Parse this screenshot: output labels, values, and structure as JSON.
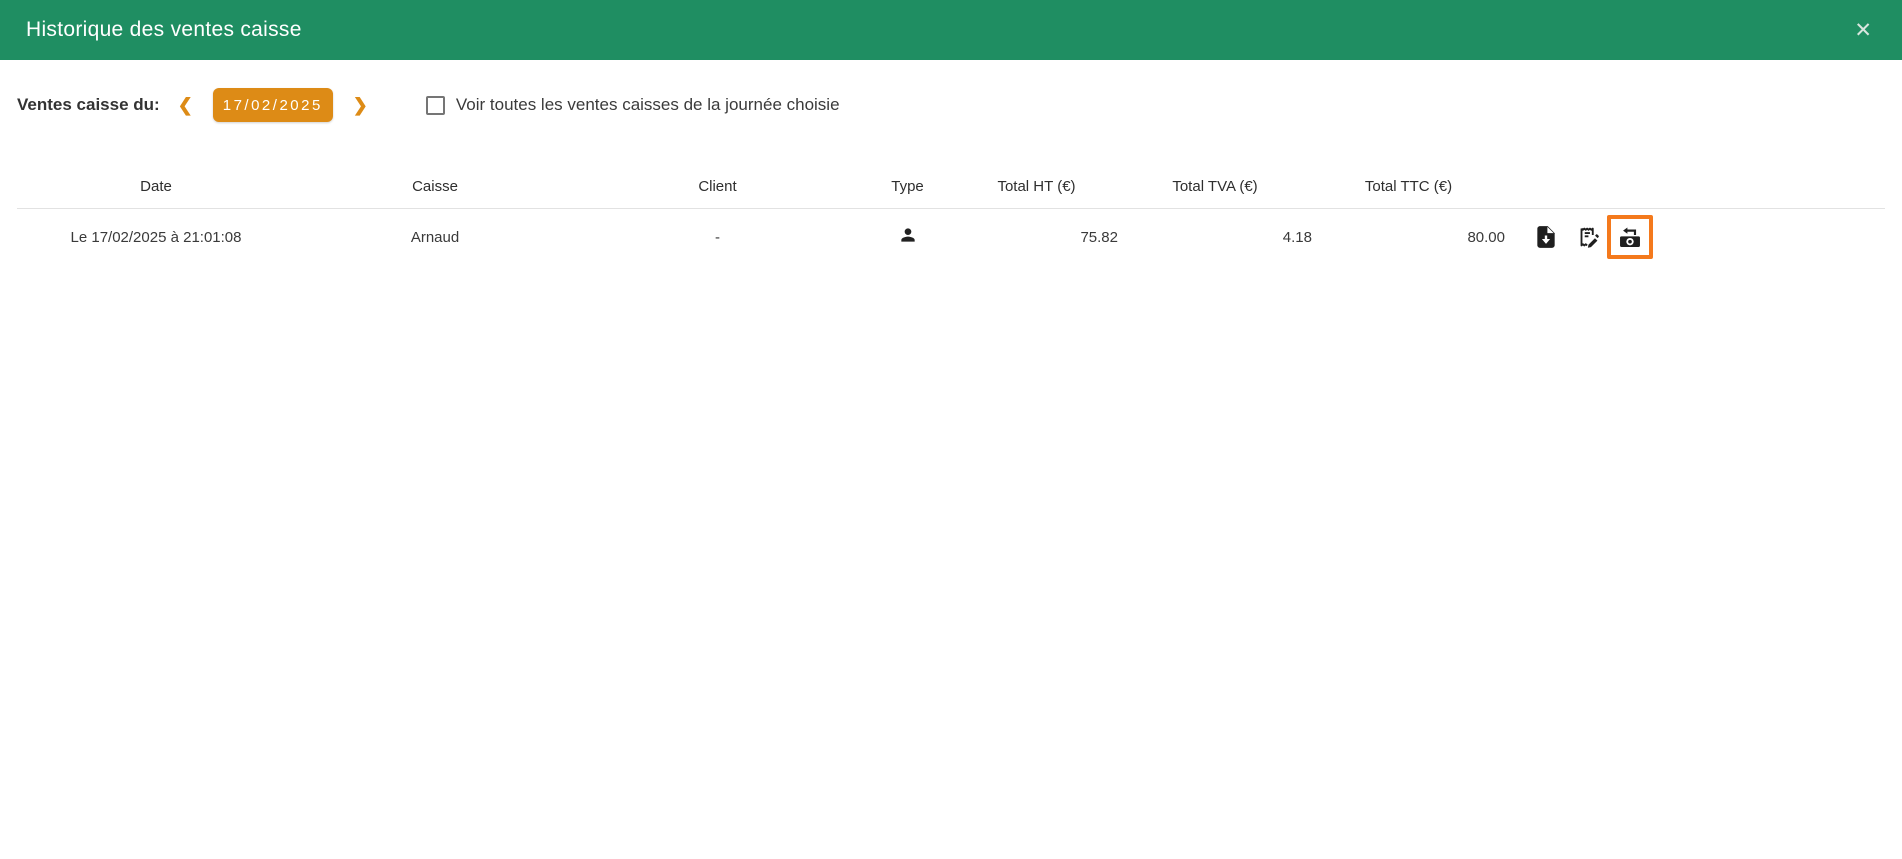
{
  "window": {
    "title": "Historique des ventes caisse",
    "close_icon": "✕"
  },
  "controls": {
    "label": "Ventes caisse du:",
    "prev_icon": "❮",
    "next_icon": "❯",
    "date_value": "17/02/2025",
    "checkbox": {
      "checked": false,
      "label": "Voir toutes les ventes caisses de la journée choisie"
    }
  },
  "table": {
    "columns": [
      "Date",
      "Caisse",
      "Client",
      "Type",
      "Total HT (€)",
      "Total TVA (€)",
      "Total TTC (€)"
    ],
    "rows": [
      {
        "date": "Le 17/02/2025 à 21:01:08",
        "caisse": "Arnaud",
        "client": "-",
        "type_icon": "person-icon",
        "total_ht": "75.82",
        "total_tva": "4.18",
        "total_ttc": "80.00",
        "actions": [
          "download-document",
          "edit-receipt",
          "refund-sale"
        ],
        "highlighted_action": "refund-sale"
      }
    ]
  },
  "colors": {
    "header_bg": "#1f8e62",
    "accent_orange": "#dd8b16",
    "highlight_orange": "#f4791c"
  }
}
